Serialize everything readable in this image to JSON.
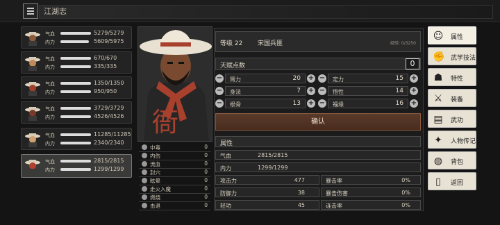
{
  "header": {
    "title": "江湖志"
  },
  "characters": [
    {
      "hp_label": "气血",
      "mp_label": "内力",
      "hp": "5279/5279",
      "mp": "5609/5975",
      "hp_frac": 1.0,
      "mp_frac": 0.94
    },
    {
      "hp_label": "气血",
      "mp_label": "内力",
      "hp": "670/670",
      "mp": "335/335",
      "hp_frac": 1.0,
      "mp_frac": 1.0
    },
    {
      "hp_label": "气血",
      "mp_label": "内力",
      "hp": "1350/1350",
      "mp": "950/950",
      "hp_frac": 1.0,
      "mp_frac": 1.0
    },
    {
      "hp_label": "气血",
      "mp_label": "内力",
      "hp": "3729/3729",
      "mp": "4526/4526",
      "hp_frac": 1.0,
      "mp_frac": 1.0
    },
    {
      "hp_label": "气血",
      "mp_label": "内力",
      "hp": "11285/11285",
      "mp": "2340/2340",
      "hp_frac": 1.0,
      "mp_frac": 1.0
    },
    {
      "hp_label": "气血",
      "mp_label": "内力",
      "hp": "2815/2815",
      "mp": "1299/1299",
      "hp_frac": 1.0,
      "mp_frac": 1.0,
      "selected": true
    }
  ],
  "status_effects": [
    {
      "label": "中毒",
      "value": "0"
    },
    {
      "label": "内伤",
      "value": "0"
    },
    {
      "label": "流血",
      "value": "0"
    },
    {
      "label": "封穴",
      "value": "0"
    },
    {
      "label": "眩晕",
      "value": "0"
    },
    {
      "label": "走火入魔",
      "value": "0"
    },
    {
      "label": "燃烧",
      "value": "0"
    },
    {
      "label": "击退",
      "value": "0"
    }
  ],
  "profile": {
    "level": "等级 22",
    "title": "宋国兵匪",
    "exp": "经验: 0/3250",
    "portrait_sign": "衙"
  },
  "talent": {
    "label": "天赋点数",
    "value": "0"
  },
  "attributes": [
    {
      "name": "臂力",
      "value": "20"
    },
    {
      "name": "定力",
      "value": "15"
    },
    {
      "name": "身法",
      "value": "7"
    },
    {
      "name": "悟性",
      "value": "14"
    },
    {
      "name": "根骨",
      "value": "13"
    },
    {
      "name": "福缘",
      "value": "16"
    }
  ],
  "confirm_label": "确认",
  "props_section": "属性",
  "vitals": [
    {
      "name": "气血",
      "value": "2815/2815"
    },
    {
      "name": "内力",
      "value": "1299/1299"
    }
  ],
  "combat": [
    {
      "name": "攻击力",
      "value": "477",
      "name2": "暴击率",
      "value2": "0%"
    },
    {
      "name": "防御力",
      "value": "38",
      "name2": "暴击伤害",
      "value2": "0%"
    },
    {
      "name": "轻功",
      "value": "45",
      "name2": "连击率",
      "value2": "0%"
    }
  ],
  "right_menu": [
    {
      "label": "属性",
      "icon": "user-icon",
      "selected": true
    },
    {
      "label": "武学技法",
      "icon": "martial-arts-icon"
    },
    {
      "label": "特性",
      "icon": "trait-icon"
    },
    {
      "label": "装备",
      "icon": "sword-icon"
    },
    {
      "label": "武功",
      "icon": "book-icon"
    },
    {
      "label": "人物传记",
      "icon": "biography-icon"
    },
    {
      "label": "背包",
      "icon": "bag-icon"
    },
    {
      "label": "返回",
      "icon": "exit-icon"
    }
  ]
}
